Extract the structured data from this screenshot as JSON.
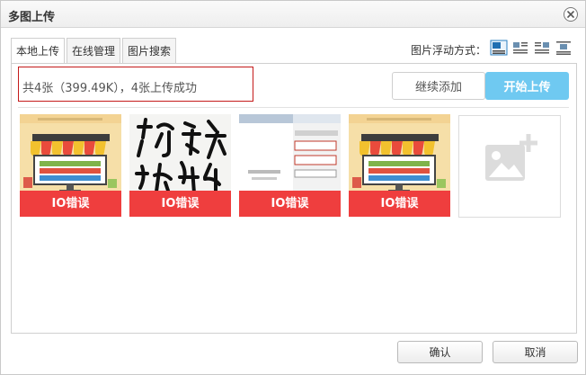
{
  "dialog": {
    "title": "多图上传"
  },
  "tabs": [
    {
      "label": "本地上传",
      "active": true
    },
    {
      "label": "在线管理",
      "active": false
    },
    {
      "label": "图片搜索",
      "active": false
    }
  ],
  "float": {
    "label": "图片浮动方式：",
    "icons": [
      "align-none-icon",
      "align-left-icon",
      "align-right-icon",
      "align-center-icon"
    ]
  },
  "upload": {
    "status": "共4张（399.49K），4张上传成功",
    "add_label": "继续添加",
    "start_label": "开始上传"
  },
  "images": [
    {
      "kind": "shop",
      "error": "IO错误"
    },
    {
      "kind": "calligraphy",
      "error": "IO错误"
    },
    {
      "kind": "screenshot",
      "error": "IO错误"
    },
    {
      "kind": "shop",
      "error": "IO错误"
    }
  ],
  "footer": {
    "ok_label": "确认",
    "cancel_label": "取消"
  },
  "colors": {
    "error": "#ef3e3e",
    "primary": "#6fc9f1",
    "status_border": "#c41a1a"
  }
}
